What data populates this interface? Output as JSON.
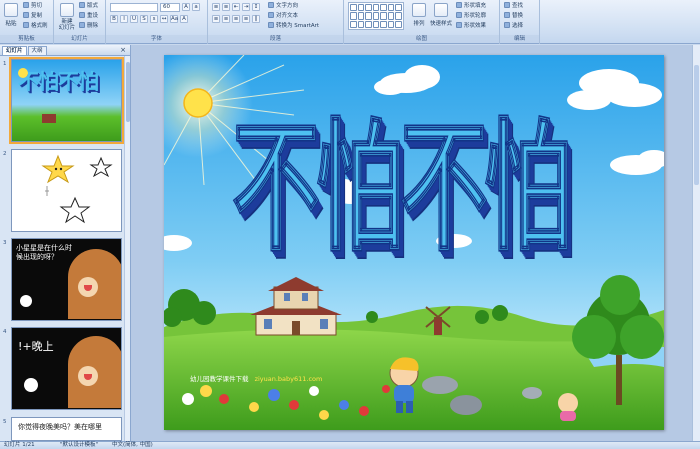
{
  "ribbon": {
    "clipboard": {
      "paste": "粘贴",
      "cut": "剪切",
      "copy": "复制",
      "format_painter": "格式刷",
      "label": "剪贴板"
    },
    "slides": {
      "new_slide": "新建\n幻灯片",
      "layout": "版式",
      "reset": "重设",
      "delete": "删除",
      "label": "幻灯片"
    },
    "font": {
      "font_size": "60",
      "label": "字体"
    },
    "paragraph": {
      "text_direction": "文字方向",
      "align_text": "对齐文本",
      "smartart": "转换为 SmartArt",
      "label": "段落"
    },
    "drawing": {
      "arrange": "排列",
      "quick_styles": "快速样式",
      "shape_fill": "形状填充",
      "shape_outline": "形状轮廓",
      "shape_effects": "形状效果",
      "label": "绘图"
    },
    "editing": {
      "find": "查找",
      "replace": "替换",
      "select": "选择",
      "label": "编辑"
    }
  },
  "pane": {
    "tabs": [
      "幻灯片",
      "大纲"
    ],
    "close": "×",
    "slides": [
      {
        "number": "1",
        "title": "不怕不怕"
      },
      {
        "number": "2",
        "title": ""
      },
      {
        "number": "3",
        "title": "小星星是在什么时候出现的呀？"
      },
      {
        "number": "4",
        "title": "!+晚上"
      },
      {
        "number": "5",
        "title": "你觉得夜晚美吗？美在哪里"
      }
    ]
  },
  "slide": {
    "title": "不怕不怕",
    "footer_text": "幼儿园教学课件下载",
    "footer_url": "ziyuan.baby611.com"
  },
  "status": {
    "slide_counter": "幻灯片 1/21",
    "theme": "\"默认设计模板\"",
    "language": "中文(简体, 中国)"
  },
  "colors": {
    "sky_top": "#2aa2ea",
    "sky_bottom": "#bfe8fb",
    "grass": "#5cbf2a",
    "title_fill": "#4ec1f0",
    "title_shadow": "#1d3c9c",
    "selection": "#f2a93b"
  }
}
